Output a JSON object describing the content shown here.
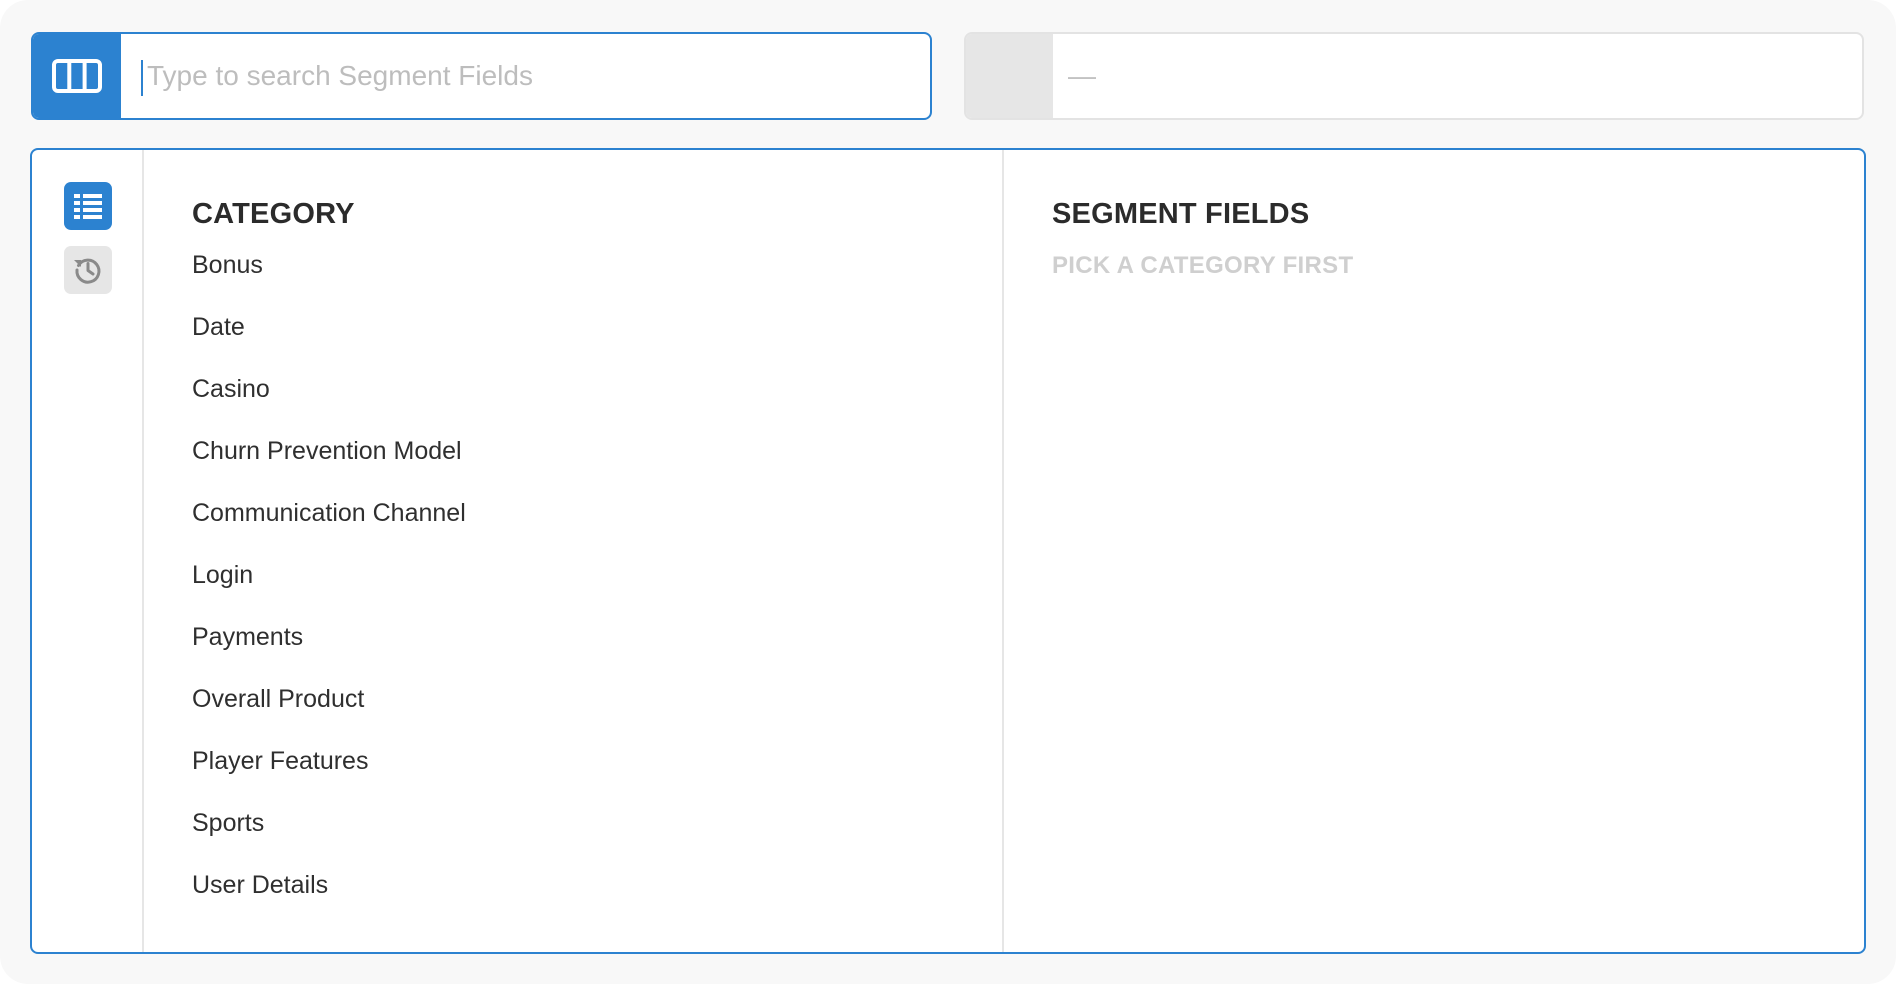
{
  "search": {
    "placeholder": "Type to search Segment Fields",
    "button_icon": "columns-icon"
  },
  "value_box": {
    "text": "—"
  },
  "rail": {
    "items": [
      {
        "icon": "list-icon",
        "active": true
      },
      {
        "icon": "history-icon",
        "active": false
      }
    ]
  },
  "category": {
    "heading": "CATEGORY",
    "items": [
      {
        "label": "Bonus"
      },
      {
        "label": "Date"
      },
      {
        "label": "Casino"
      },
      {
        "label": "Churn Prevention Model"
      },
      {
        "label": "Communication Channel"
      },
      {
        "label": "Login"
      },
      {
        "label": "Payments"
      },
      {
        "label": "Overall Product"
      },
      {
        "label": "Player Features"
      },
      {
        "label": "Sports"
      },
      {
        "label": "User Details"
      }
    ]
  },
  "segment_fields": {
    "heading": "SEGMENT FIELDS",
    "empty_hint": "PICK A CATEGORY FIRST"
  },
  "colors": {
    "accent": "#2c82d0",
    "border_muted": "#e6e6e6",
    "hint": "#cfcfcf"
  }
}
